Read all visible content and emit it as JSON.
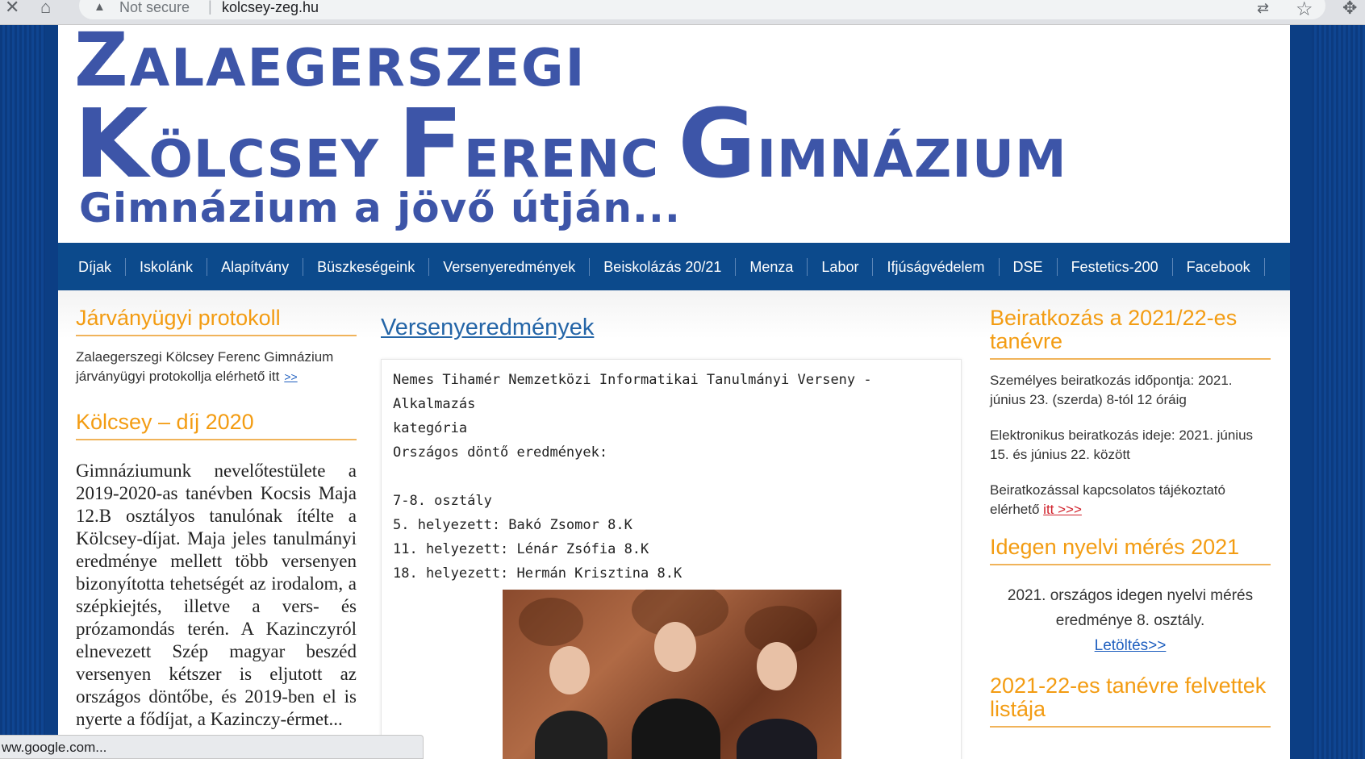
{
  "browser": {
    "security_label": "Not secure",
    "url": "kolcsey-zeg.hu",
    "status_url": "ww.google.com..."
  },
  "header": {
    "logo_line1_initial": "Z",
    "logo_line1_rest": "ALAEGERSZEGI",
    "logo_line2_k": "K",
    "logo_line2_olcsey": "ÖLCSEY ",
    "logo_line2_f": "F",
    "logo_line2_erenc": "ERENC ",
    "logo_line2_g": "G",
    "logo_line2_imnazium": "IMNÁZIUM",
    "tagline": "Gimnázium a jövő útján..."
  },
  "nav": {
    "items": [
      "Díjak",
      "Iskolánk",
      "Alapítvány",
      "Büszkeségeink",
      "Versenyeredmények",
      "Beiskolázás 20/21",
      "Menza",
      "Labor",
      "Ifjúságvédelem",
      "DSE",
      "Festetics-200",
      "Facebook"
    ]
  },
  "left": {
    "protocol_title": "Járványügyi protokoll",
    "protocol_text": "Zalaegerszegi Kölcsey Ferenc Gimnázium járványügyi protokollja elérhető itt",
    "protocol_link": ">>",
    "award_title": "Kölcsey – díj 2020",
    "award_text": "Gimnáziumunk nevelőtestülete a 2019-2020-as tanévben Kocsis Maja 12.B osztályos tanulónak ítélte a Kölcsey-díjat. Maja jeles tanulmányi eredménye mellett több versenyen bizonyította tehetségét az irodalom, a szépkiejtés, illetve a vers- és prózamondás terén. A Kazinczyról elnevezett Szép magyar beszéd versenyen kétszer is eljutott az országos döntőbe, és 2019-ben el is nyerte a fődíjat, a Kazinczy-érmet..."
  },
  "main": {
    "heading": "Versenyeredmények",
    "lines": [
      "Nemes Tihamér Nemzetközi Informatikai Tanulmányi Verseny - Alkalmazás",
      "kategória",
      "Országos döntő eredmények:",
      "",
      "7-8. osztály",
      "5. helyezett: Bakó Zsomor 8.K",
      "11. helyezett: Lénár Zsófia 8.K",
      "18. helyezett: Hermán Krisztina 8.K"
    ]
  },
  "right": {
    "enroll_title": "Beiratkozás a 2021/22-es tanévre",
    "enroll_p1": "Személyes beiratkozás időpontja: 2021. június 23. (szerda) 8-tól 12 óráig",
    "enroll_p2": "Elektronikus beiratkozás ideje: 2021. június 15. és június 22. között",
    "enroll_p3": "Beiratkozással kapcsolatos tájékoztató elérhető",
    "enroll_link": "itt >>>",
    "lang_title": "Idegen nyelvi mérés 2021",
    "lang_text": "2021. országos idegen nyelvi mérés eredménye 8. osztály.",
    "lang_link": "Letöltés>>",
    "admit_title": "2021-22-es tanévre felvettek listája"
  }
}
